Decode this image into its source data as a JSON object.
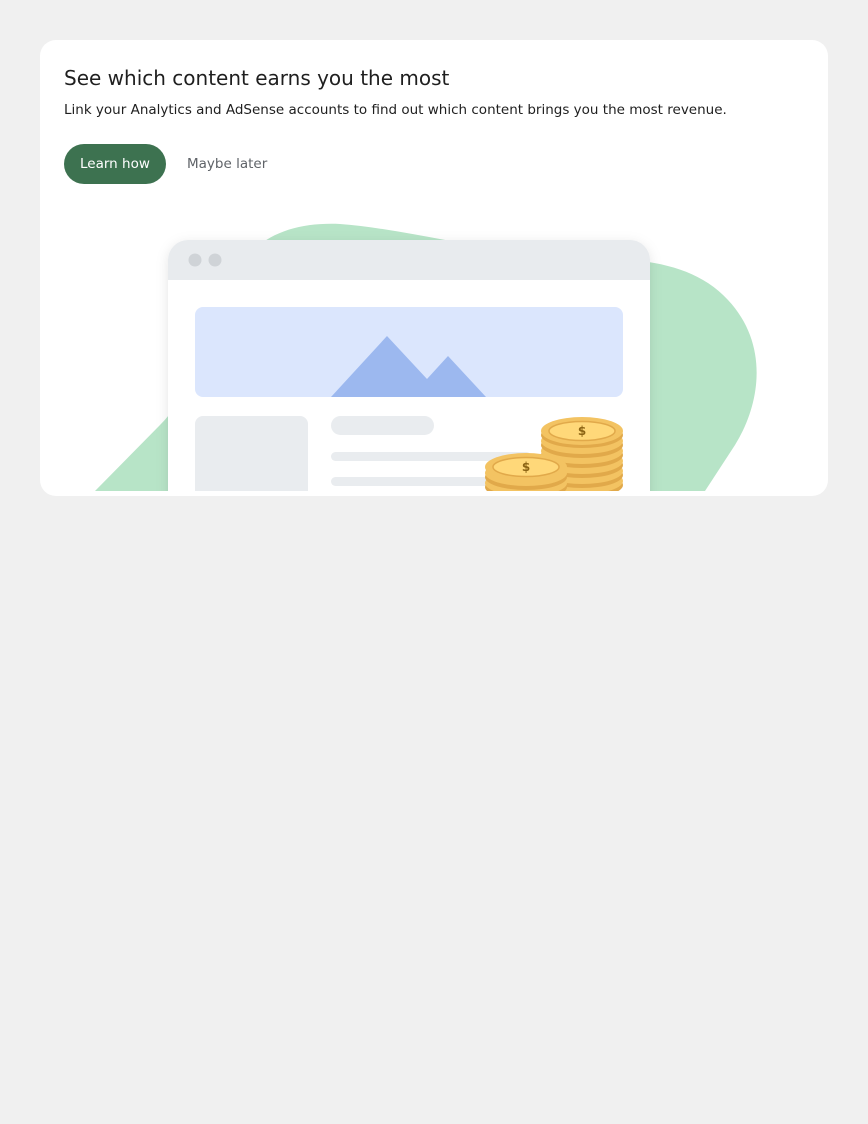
{
  "promo": {
    "title": "See which content earns you the most",
    "description": "Link your Analytics and AdSense accounts to find out which content brings you the most revenue.",
    "primary_action": "Learn how",
    "secondary_action": "Maybe later"
  },
  "illustration": {
    "coin_symbol": "$",
    "colors": {
      "blob": "#b7e4c7",
      "browser_header": "#e8ebee",
      "hero_bg": "#dbe6fd",
      "mountains": "#9cb8ef",
      "placeholder": "#e9ecef",
      "coin_fill": "#f3c362",
      "coin_edge": "#e1a94a",
      "coin_symbol": "#8c6414",
      "primary_button": "#3d7250"
    }
  }
}
